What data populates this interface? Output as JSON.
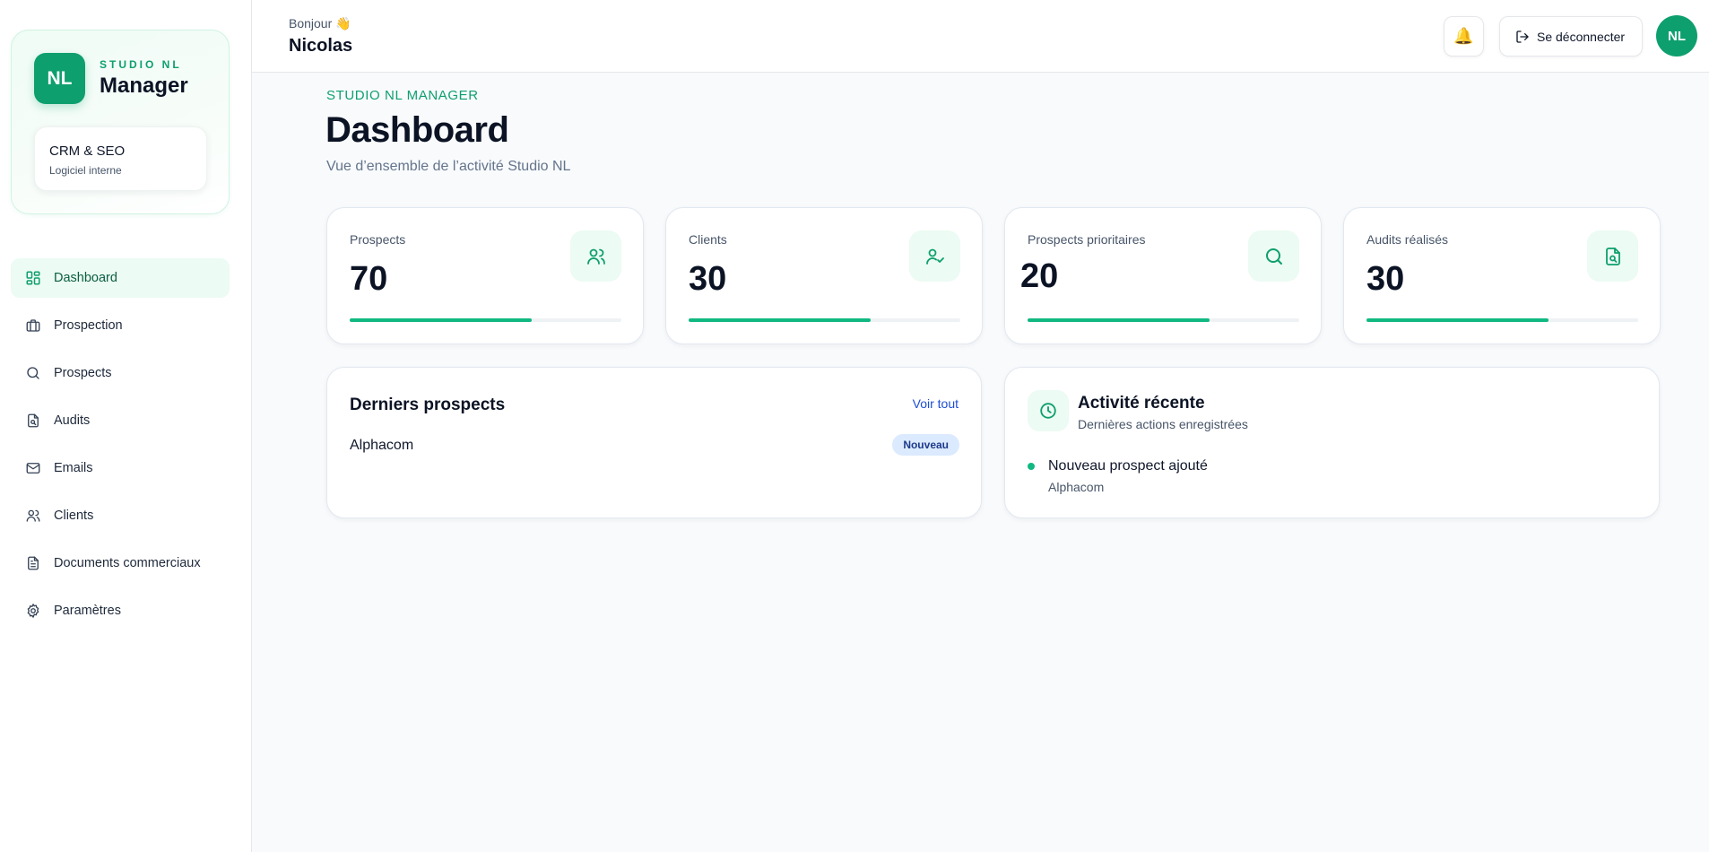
{
  "sidebar": {
    "logo": "NL",
    "brand_top": "STUDIO NL",
    "brand_main": "Manager",
    "info_title": "CRM & SEO",
    "info_sub": "Logiciel interne",
    "items": [
      {
        "label": "Dashboard",
        "icon": "dashboard-icon",
        "active": true
      },
      {
        "label": "Prospection",
        "icon": "briefcase-icon"
      },
      {
        "label": "Prospects",
        "icon": "search-icon"
      },
      {
        "label": "Audits",
        "icon": "file-search-icon"
      },
      {
        "label": "Emails",
        "icon": "mail-icon"
      },
      {
        "label": "Clients",
        "icon": "users-icon"
      },
      {
        "label": "Documents commerciaux",
        "icon": "document-icon"
      },
      {
        "label": "Paramètres",
        "icon": "gear-icon"
      }
    ]
  },
  "header": {
    "greeting": "Bonjour 👋",
    "username": "Nicolas",
    "bell": "🔔",
    "logout_label": "Se déconnecter",
    "avatar": "NL"
  },
  "main": {
    "eyebrow": "STUDIO NL MANAGER",
    "title": "Dashboard",
    "subtitle": "Vue d’ensemble de l’activité Studio NL",
    "stats": [
      {
        "label": "Prospects",
        "value": "70",
        "icon": "users-icon",
        "progress": 0.67
      },
      {
        "label": "Clients",
        "value": "30",
        "icon": "user-check-icon",
        "progress": 0.67
      },
      {
        "label": "Prospects prioritaires",
        "value": "20",
        "icon": "search-icon",
        "progress": 0.67
      },
      {
        "label": "Audits réalisés",
        "value": "30",
        "icon": "file-search-icon",
        "progress": 0.67
      }
    ],
    "latest_prospects": {
      "title": "Derniers prospects",
      "see_all": "Voir tout",
      "items": [
        {
          "name": "Alphacom",
          "badge": "Nouveau"
        }
      ]
    },
    "activity": {
      "title": "Activité récente",
      "subtitle": "Dernières actions enregistrées",
      "items": [
        {
          "title": "Nouveau prospect ajouté",
          "sub": "Alphacom"
        }
      ]
    }
  },
  "colors": {
    "accent": "#0e9f6e",
    "progress": "#10b981",
    "active_bg": "#ecfbf3",
    "badge_bg": "#dbeafe",
    "link": "#1d4ed8"
  }
}
